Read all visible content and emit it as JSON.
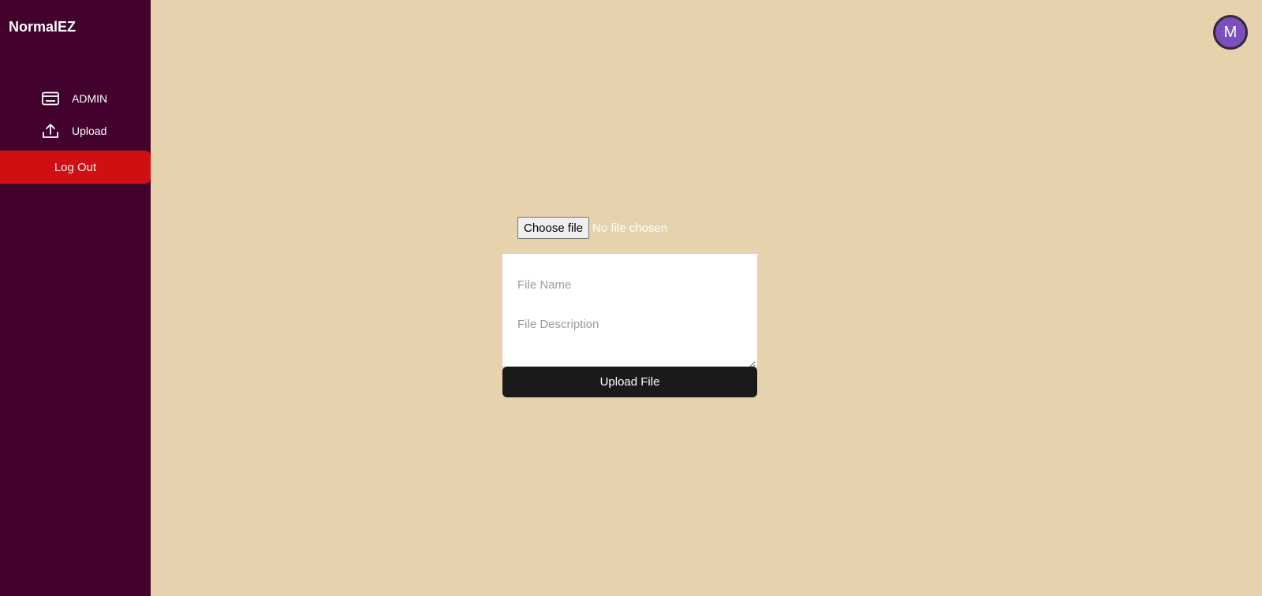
{
  "app": {
    "brand": "NormalEZ"
  },
  "sidebar": {
    "items": [
      {
        "label": "ADMIN",
        "icon": "admin-card-icon"
      },
      {
        "label": "Upload",
        "icon": "upload-icon"
      }
    ],
    "logout_label": "Log Out"
  },
  "header": {
    "avatar_initial": "M"
  },
  "form": {
    "choose_file_label": "Choose file",
    "no_file_text": "No file chosen",
    "file_name_placeholder": "File Name",
    "file_name_value": "",
    "file_description_placeholder": "File Description",
    "file_description_value": "",
    "upload_button_label": "Upload File"
  },
  "colors": {
    "sidebar_bg": "#42022d",
    "page_bg": "#e6d2ac",
    "logout_bg": "#cf0f12",
    "avatar_bg": "#7b4fbe",
    "upload_button_bg": "#1a1a1a"
  }
}
